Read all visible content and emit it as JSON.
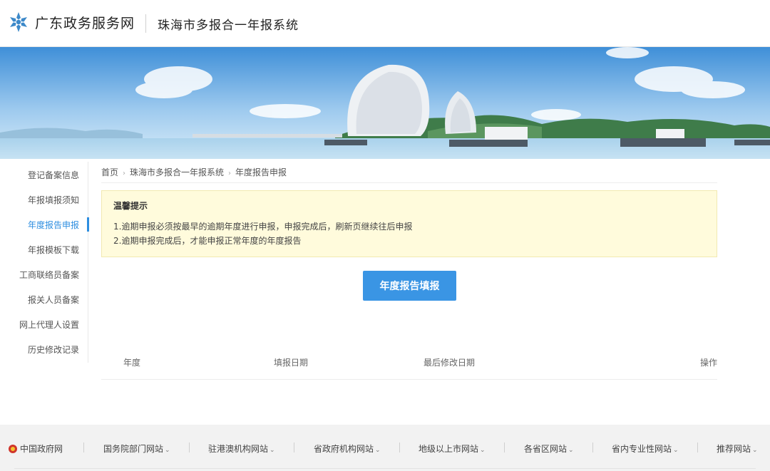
{
  "header": {
    "site_name": "广东政务服务网",
    "system_name": "珠海市多报合一年报系统"
  },
  "sidebar": {
    "items": [
      {
        "label": "登记备案信息"
      },
      {
        "label": "年报填报须知"
      },
      {
        "label": "年度报告申报",
        "active": true
      },
      {
        "label": "年报模板下载"
      },
      {
        "label": "工商联络员备案"
      },
      {
        "label": "报关人员备案"
      },
      {
        "label": "网上代理人设置"
      },
      {
        "label": "历史修改记录"
      }
    ]
  },
  "breadcrumb": [
    "首页",
    "珠海市多报合一年报系统",
    "年度报告申报"
  ],
  "notice": {
    "title": "温馨提示",
    "lines": [
      "1.逾期申报必须按最早的逾期年度进行申报，申报完成后，刷新页继续往后申报",
      "2.逾期申报完成后，才能申报正常年度的年度报告"
    ]
  },
  "actions": {
    "fill_report": "年度报告填报"
  },
  "table": {
    "columns": [
      "年度",
      "填报日期",
      "最后修改日期",
      "操作"
    ]
  },
  "footer": {
    "links": [
      "中国政府网",
      "国务院部门网站",
      "驻港澳机构网站",
      "省政府机构网站",
      "地级以上市网站",
      "各省区网站",
      "省内专业性网站",
      "推荐网站"
    ]
  },
  "colors": {
    "accent": "#3a95e4",
    "notice_bg": "#fffbdc",
    "footer_bg": "#f2f2f2"
  }
}
